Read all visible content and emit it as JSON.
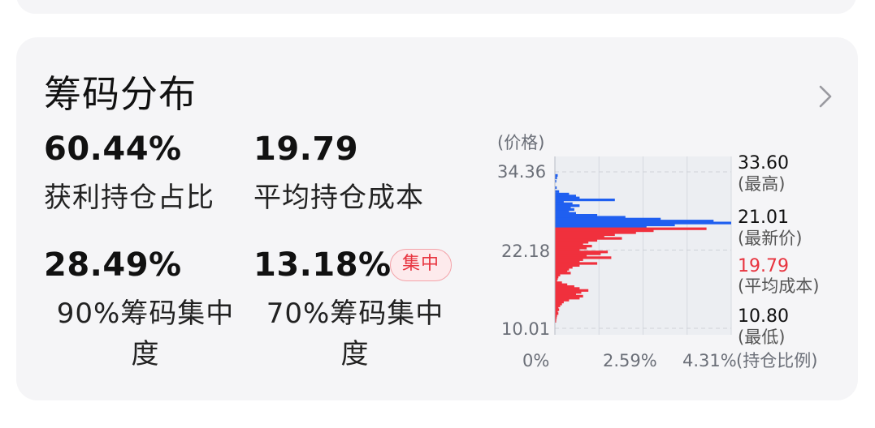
{
  "card": {
    "title": "筹码分布",
    "more_icon": "chevron-right-icon"
  },
  "stats": {
    "profit_ratio_value": "60.44%",
    "profit_ratio_label": "获利持仓占比",
    "avg_cost_value": "19.79",
    "avg_cost_label": "平均持仓成本",
    "conc90_value": "28.49%",
    "conc90_label_line1": "90%筹码集中",
    "conc90_label_line2": "度",
    "conc70_value": "13.18%",
    "conc70_label_line1": "70%筹码集中",
    "conc70_label_line2": "度",
    "conc70_badge": "集中"
  },
  "colors": {
    "profit": "#1f5ff0",
    "loss": "#f0303d",
    "accent_red": "#e8343f"
  },
  "chart_data": {
    "type": "bar",
    "orientation": "horizontal",
    "y_axis_label": "(价格)",
    "y_ticks": [
      "34.36",
      "22.18",
      "10.01"
    ],
    "y_range": [
      10.01,
      34.36
    ],
    "x_axis_label": "(持仓比例)",
    "x_ticks": [
      "0%",
      "2.59%",
      "4.31%"
    ],
    "x_range_pct": [
      0,
      5.0
    ],
    "grid": true,
    "markers": {
      "high_value": "33.60",
      "high_label": "(最高)",
      "latest_value": "21.01",
      "latest_label": "(最新价)",
      "avg_value": "19.79",
      "avg_label": "(平均成本)",
      "low_value": "10.80",
      "low_label": "(最低)"
    },
    "series": [
      {
        "color_key": "profit",
        "points": [
          [
            33.8,
            0.08
          ],
          [
            33.4,
            0.06
          ],
          [
            32.9,
            0.04
          ],
          [
            31.9,
            0.05
          ],
          [
            31.3,
            0.12
          ],
          [
            30.9,
            0.4
          ],
          [
            30.6,
            0.6
          ],
          [
            30.3,
            0.7
          ],
          [
            30.0,
            1.7
          ],
          [
            29.7,
            0.25
          ],
          [
            29.4,
            0.5
          ],
          [
            29.1,
            0.7
          ],
          [
            28.8,
            0.45
          ],
          [
            28.5,
            0.55
          ],
          [
            28.2,
            0.4
          ],
          [
            27.9,
            0.6
          ],
          [
            27.6,
            1.2
          ],
          [
            27.3,
            2.0
          ],
          [
            27.0,
            3.0
          ],
          [
            26.7,
            4.5
          ],
          [
            26.4,
            5.0
          ],
          [
            26.1,
            3.4
          ],
          [
            25.8,
            2.6
          ]
        ]
      },
      {
        "color_key": "loss",
        "points": [
          [
            25.5,
            4.3
          ],
          [
            25.2,
            2.8
          ],
          [
            24.9,
            2.3
          ],
          [
            24.6,
            1.7
          ],
          [
            24.3,
            1.4
          ],
          [
            24.0,
            1.9
          ],
          [
            23.7,
            1.2
          ],
          [
            23.4,
            0.95
          ],
          [
            23.1,
            0.8
          ],
          [
            22.8,
            1.05
          ],
          [
            22.5,
            0.9
          ],
          [
            22.2,
            0.7
          ],
          [
            21.9,
            1.5
          ],
          [
            21.6,
            1.3
          ],
          [
            21.3,
            0.9
          ],
          [
            21.0,
            1.6
          ],
          [
            20.7,
            0.8
          ],
          [
            20.4,
            0.7
          ],
          [
            20.1,
            1.2
          ],
          [
            19.8,
            0.7
          ],
          [
            19.5,
            0.5
          ],
          [
            19.2,
            0.4
          ],
          [
            18.9,
            0.35
          ],
          [
            18.6,
            0.45
          ],
          [
            18.3,
            0.15
          ],
          [
            18.0,
            0.1
          ],
          [
            17.7,
            0.08
          ],
          [
            17.4,
            0.06
          ],
          [
            17.1,
            0.2
          ],
          [
            16.8,
            0.35
          ],
          [
            16.5,
            0.55
          ],
          [
            16.2,
            0.7
          ],
          [
            15.9,
            0.95
          ],
          [
            15.6,
            0.75
          ],
          [
            15.3,
            0.6
          ],
          [
            15.0,
            0.8
          ],
          [
            14.7,
            0.7
          ],
          [
            14.4,
            0.4
          ],
          [
            14.1,
            0.25
          ],
          [
            13.8,
            0.2
          ],
          [
            13.5,
            0.15
          ],
          [
            13.2,
            0.1
          ],
          [
            12.9,
            0.12
          ],
          [
            12.6,
            0.08
          ],
          [
            12.3,
            0.1
          ],
          [
            12.0,
            0.06
          ],
          [
            11.7,
            0.05
          ],
          [
            11.4,
            0.04
          ],
          [
            11.1,
            0.03
          ]
        ]
      }
    ]
  }
}
